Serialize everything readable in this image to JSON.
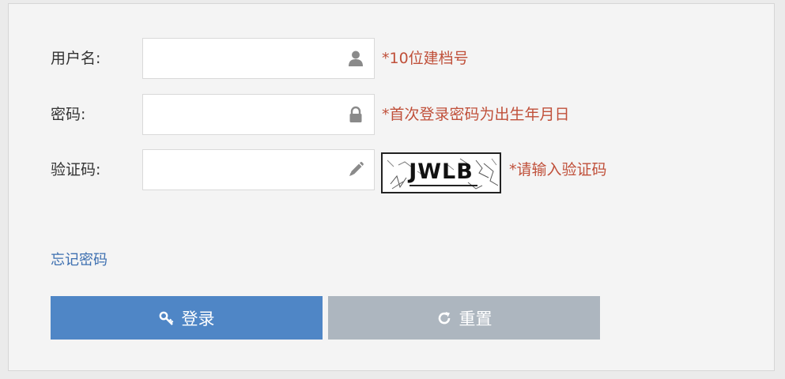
{
  "form": {
    "username": {
      "label": "用户名:",
      "value": "",
      "placeholder": "",
      "icon": "user-icon",
      "hint": "*10位建档号"
    },
    "password": {
      "label": "密码:",
      "value": "",
      "placeholder": "",
      "icon": "lock-icon",
      "hint": "*首次登录密码为出生年月日"
    },
    "captcha": {
      "label": "验证码:",
      "value": "",
      "placeholder": "",
      "icon": "pencil-icon",
      "image_text": "JWLB",
      "hint": "*请输入验证码"
    },
    "forgot_password_label": "忘记密码",
    "login_button": {
      "label": "登录",
      "icon": "key-icon"
    },
    "reset_button": {
      "label": "重置",
      "icon": "refresh-icon"
    }
  },
  "colors": {
    "hint": "#c0503a",
    "link": "#3d6fb0",
    "login_bg": "#4f86c6",
    "reset_bg": "#adb6bf",
    "panel_bg": "#f4f4f4"
  }
}
